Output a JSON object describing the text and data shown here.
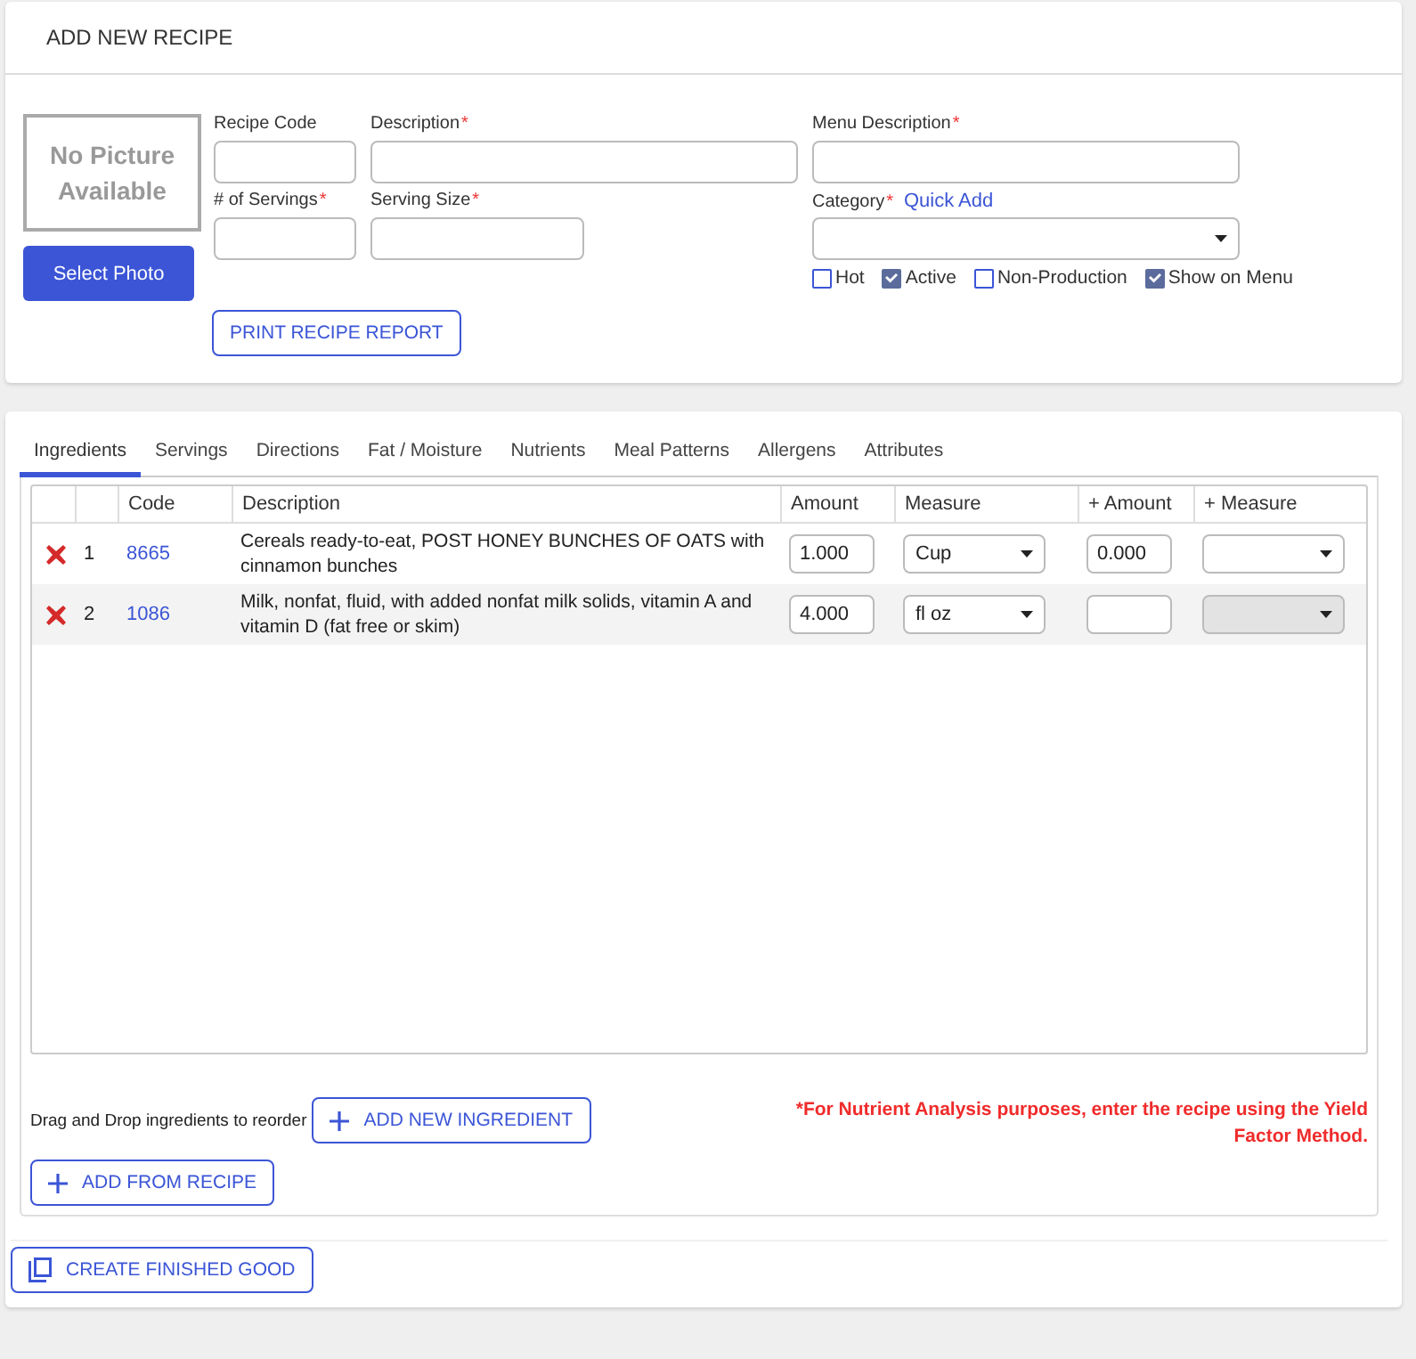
{
  "header": {
    "title": "ADD NEW RECIPE"
  },
  "photo": {
    "placeholder": "No Picture Available",
    "button": "Select Photo"
  },
  "fields": [
    {
      "label": "Recipe Code",
      "kind": "text"
    },
    {
      "label": "Description",
      "required_mark": "*",
      "kind": "text"
    },
    {
      "label": "Menu Description",
      "required_mark": "*",
      "kind": "text"
    },
    {
      "label": "# of Servings",
      "required_mark": "*",
      "kind": "text"
    },
    {
      "label": "Serving Size",
      "required_mark": "*",
      "kind": "text"
    },
    {
      "label": "Category",
      "required_mark": "*",
      "link": "Quick Add",
      "kind": "select"
    }
  ],
  "flags": [
    {
      "label": "Hot",
      "checked": false
    },
    {
      "label": "Active",
      "checked": true
    },
    {
      "label": "Non-Production",
      "checked": false
    },
    {
      "label": "Show on Menu",
      "checked": true
    }
  ],
  "print_button": "PRINT RECIPE REPORT",
  "tabs": [
    {
      "label": "Ingredients",
      "selected": true
    },
    {
      "label": "Servings",
      "selected": false
    },
    {
      "label": "Directions",
      "selected": false
    },
    {
      "label": "Fat / Moisture",
      "selected": false
    },
    {
      "label": "Nutrients",
      "selected": false
    },
    {
      "label": "Meal Patterns",
      "selected": false
    },
    {
      "label": "Allergens",
      "selected": false
    },
    {
      "label": "Attributes",
      "selected": false
    }
  ],
  "table": {
    "columns": [
      "Code",
      "Description",
      "Amount",
      "Measure",
      "+ Amount",
      "+ Measure"
    ],
    "rows": [
      {
        "line": "1",
        "code": "8665",
        "description": "Cereals ready-to-eat, POST HONEY BUNCHES OF OATS with cinnamon bunches",
        "amount": "1.000",
        "measure": "Cup",
        "plus_amount": "0.000",
        "plus_measure_disabled": false,
        "selected": false
      },
      {
        "line": "2",
        "code": "1086",
        "description": "Milk, nonfat, fluid, with added nonfat milk solids, vitamin A and vitamin D (fat free or skim)",
        "amount": "4.000",
        "measure": "fl oz",
        "plus_measure_disabled": true,
        "selected": true
      }
    ]
  },
  "reorder_hint": "Drag and Drop ingredients to reorder",
  "add_ingredient_button": "ADD NEW INGREDIENT",
  "nutrient_note": "*For Nutrient Analysis purposes, enter the recipe using the Yield Factor Method.",
  "add_from_recipe_button": "ADD FROM RECIPE",
  "create_button": "CREATE FINISHED GOOD"
}
